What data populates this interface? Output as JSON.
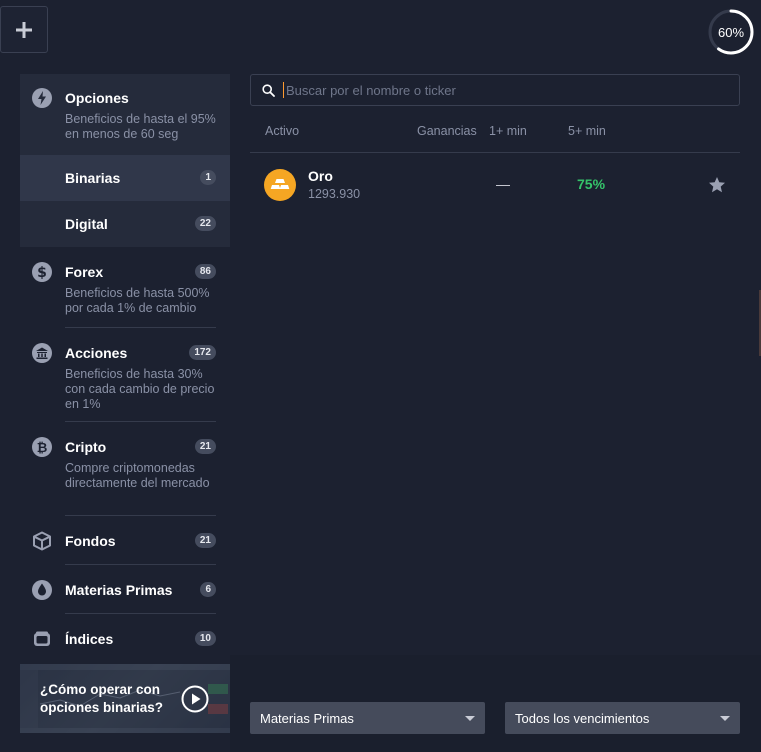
{
  "header": {
    "add_label": "+",
    "progress_label": "60%",
    "progress_fraction": 0.6
  },
  "sidebar": {
    "opciones": {
      "title": "Opciones",
      "desc": "Beneficios de hasta el 95% en menos de 60 seg",
      "subs": [
        {
          "label": "Binarias",
          "count": "1"
        },
        {
          "label": "Digital",
          "count": "22"
        }
      ]
    },
    "categories": [
      {
        "title": "Forex",
        "count": "86",
        "desc": "Beneficios de hasta 500% por cada 1% de cambio"
      },
      {
        "title": "Acciones",
        "count": "172",
        "desc": "Beneficios de hasta 30% con cada cambio de precio en 1%"
      },
      {
        "title": "Cripto",
        "count": "21",
        "desc": "Compre criptomonedas directamente del mercado"
      },
      {
        "title": "Fondos",
        "count": "21"
      },
      {
        "title": "Materias Primas",
        "count": "6"
      },
      {
        "title": "Índices",
        "count": "10"
      }
    ],
    "promo": "¿Cómo operar con opciones binarias?"
  },
  "search": {
    "placeholder": "Buscar por el nombre o ticker"
  },
  "table": {
    "columns": [
      "Activo",
      "Ganancias",
      "1+ min",
      "5+ min"
    ],
    "rows": [
      {
        "name": "Oro",
        "price": "1293.930",
        "min1": "—",
        "min5": "75%"
      }
    ]
  },
  "filters": {
    "category": "Materias Primas",
    "expiry": "Todos los vencimientos"
  },
  "colors": {
    "background": "#1c2130",
    "accent_green": "#35c46a",
    "gold": "#f5a623",
    "active_item": "#30374a"
  }
}
